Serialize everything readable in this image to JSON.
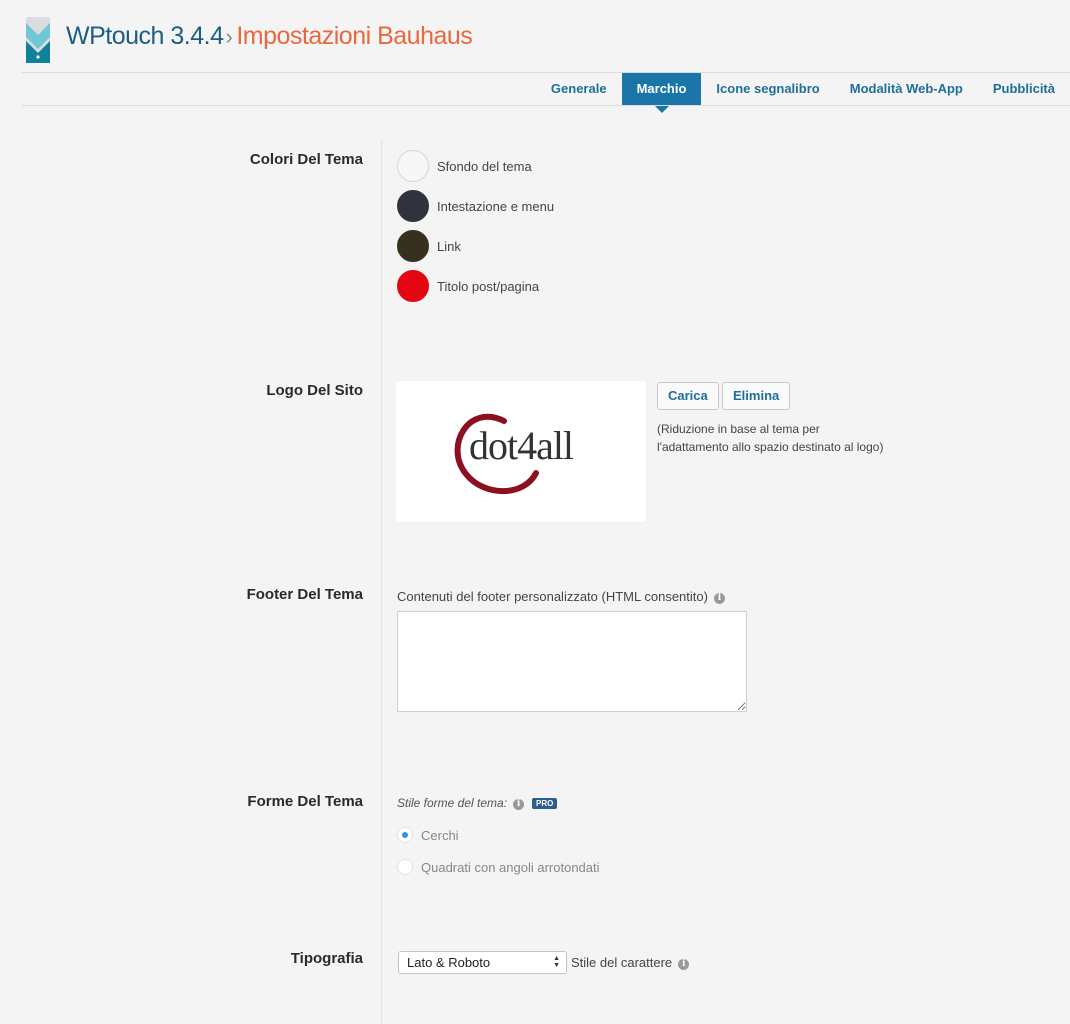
{
  "header": {
    "app_name": "WPtouch 3.4.4",
    "separator": "›",
    "page_title": "Impostazioni Bauhaus"
  },
  "tabs": [
    {
      "label": "Generale",
      "active": false
    },
    {
      "label": "Marchio",
      "active": true
    },
    {
      "label": "Icone segnalibro",
      "active": false
    },
    {
      "label": "Modalità Web-App",
      "active": false
    },
    {
      "label": "Pubblicità",
      "active": false
    }
  ],
  "colors_section": {
    "label": "Colori Del Tema",
    "items": [
      {
        "label": "Sfondo del tema",
        "color": "#f7f7f7"
      },
      {
        "label": "Intestazione e menu",
        "color": "#2e333d"
      },
      {
        "label": "Link",
        "color": "#36301e"
      },
      {
        "label": "Titolo post/pagina",
        "color": "#e30612"
      }
    ]
  },
  "logo_section": {
    "label": "Logo Del Sito",
    "logo_text": "dot4all",
    "upload_label": "Carica",
    "delete_label": "Elimina",
    "hint_line1": "(Riduzione in base al tema per",
    "hint_line2": "l'adattamento allo spazio destinato al logo)"
  },
  "footer_section": {
    "label": "Footer Del Tema",
    "field_label": "Contenuti del footer personalizzato (HTML consentito)",
    "value": ""
  },
  "shapes_section": {
    "label": "Forme Del Tema",
    "style_label": "Stile forme del tema:",
    "pro_badge": "PRO",
    "options": [
      {
        "label": "Cerchi",
        "checked": true
      },
      {
        "label": "Quadrati con angoli arrotondati",
        "checked": false
      }
    ]
  },
  "typography_section": {
    "label": "Tipografia",
    "selected_font": "Lato & Roboto",
    "field_label": "Stile del carattere"
  },
  "icons": {
    "info": "info-icon",
    "app_logo": "wptouch-logo-icon"
  },
  "theme_colors": {
    "accent": "#1a75a8",
    "title_orange": "#e8683f",
    "logo_red": "#8c1020"
  }
}
